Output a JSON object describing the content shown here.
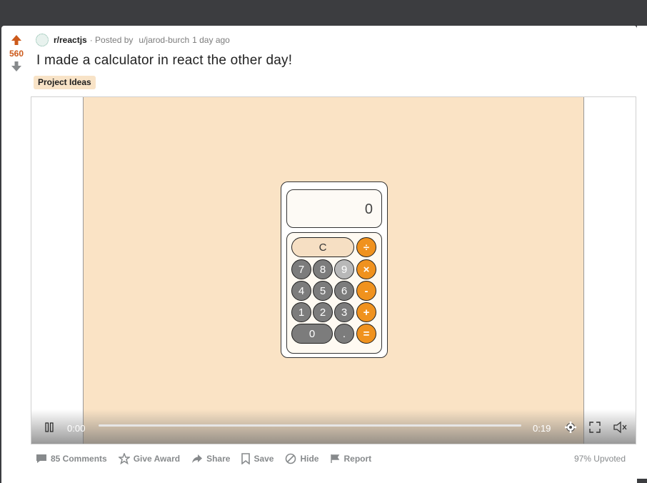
{
  "post": {
    "score": "560",
    "subreddit": "r/reactjs",
    "posted_by_prefix": "· Posted by",
    "author": "u/jarod-burch",
    "age": "1 day ago",
    "title": "I made a calculator in react the other day!",
    "flair": "Project Ideas"
  },
  "calculator": {
    "display": "0",
    "keys": {
      "clear": "C",
      "divide": "÷",
      "multiply": "×",
      "minus": "-",
      "plus": "+",
      "equals": "=",
      "k7": "7",
      "k8": "8",
      "k9": "9",
      "k4": "4",
      "k5": "5",
      "k6": "6",
      "k1": "1",
      "k2": "2",
      "k3": "3",
      "k0": "0",
      "dot": "."
    }
  },
  "video": {
    "current_time": "0:00",
    "duration": "0:19",
    "progress_fraction": 0.0
  },
  "actions": {
    "comments": "85 Comments",
    "award": "Give Award",
    "share": "Share",
    "save": "Save",
    "hide": "Hide",
    "report": "Report",
    "upvoted": "97% Upvoted"
  },
  "colors": {
    "upvote": "#cc5a1b",
    "flair_bg": "#f8e3c7",
    "video_bg": "#fae3c5",
    "operator": "#f0921e"
  },
  "icons": [
    "upvote-icon",
    "downvote-icon",
    "subreddit-icon",
    "pause-icon",
    "settings-icon",
    "fullscreen-icon",
    "mute-icon",
    "comment-icon",
    "award-icon",
    "share-icon",
    "save-icon",
    "hide-icon",
    "report-icon"
  ]
}
